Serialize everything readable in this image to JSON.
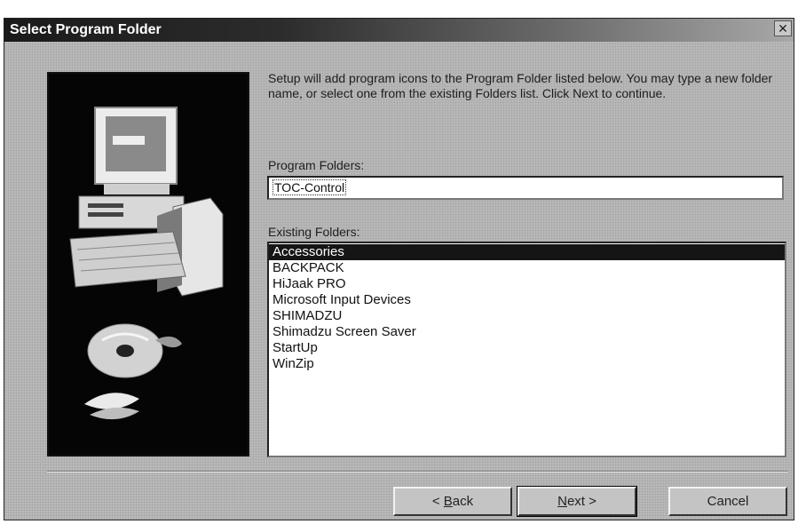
{
  "dialog": {
    "title": "Select Program Folder",
    "close_symbol": "✕"
  },
  "instructions": "Setup will add program icons to the Program Folder listed below. You may type a new folder name, or select one from the existing Folders list. Click Next to continue.",
  "program_folders": {
    "label": "Program Folders:",
    "value": "TOC-Control"
  },
  "existing_folders": {
    "label": "Existing Folders:",
    "items": [
      "Accessories",
      "BACKPACK",
      "HiJaak PRO",
      "Microsoft Input Devices",
      "SHIMADZU",
      "Shimadzu Screen Saver",
      "StartUp",
      "WinZip"
    ],
    "selected": "Accessories"
  },
  "buttons": {
    "back": {
      "pre": "< ",
      "accel": "B",
      "post": "ack"
    },
    "next": {
      "accel": "N",
      "post": "ext >"
    },
    "cancel": "Cancel"
  },
  "icons": {
    "close": "close-icon",
    "setup_art": "computer-setup-illustration"
  }
}
